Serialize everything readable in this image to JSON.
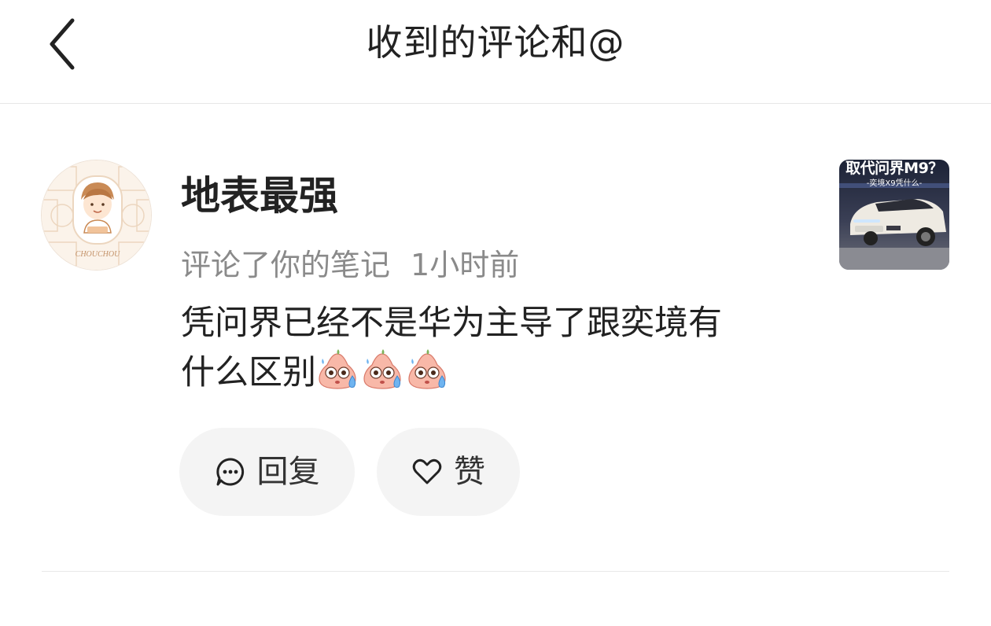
{
  "header": {
    "title": "收到的评论和@",
    "back_icon": "chevron-left-icon"
  },
  "comment": {
    "username": "地表最强",
    "action_text": "评论了你的笔记",
    "time": "1小时前",
    "content_line1": "凭问界已经不是华为主导了跟奕境有",
    "content_line2": "什么区别",
    "emojis": [
      "sweat-emoji",
      "sweat-emoji",
      "sweat-emoji"
    ],
    "avatar": {
      "caption": "CHOUCHOU"
    },
    "note_thumbnail": {
      "caption": "取代问界M9？",
      "subcaption": "-奕境X9凭什么-"
    }
  },
  "actions": {
    "reply_label": "回复",
    "reply_icon": "comment-bubble-icon",
    "like_label": "赞",
    "like_icon": "heart-outline-icon"
  }
}
